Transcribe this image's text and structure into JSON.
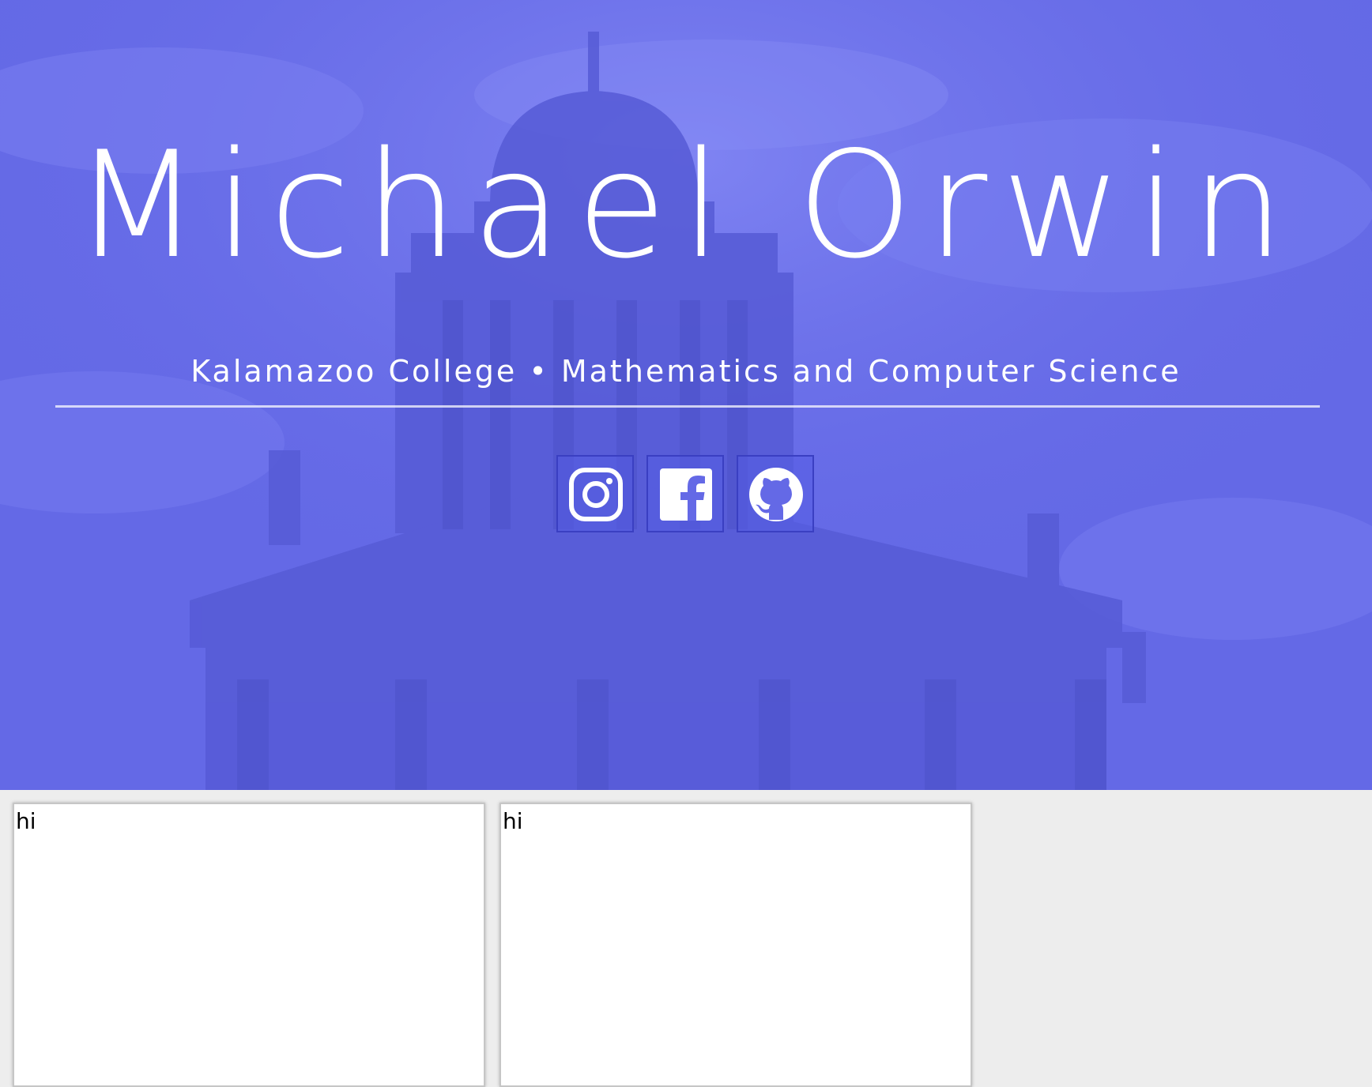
{
  "header": {
    "name": "Michael Orwin",
    "subtitle": "Kalamazoo College • Mathematics and Computer Science",
    "background_color": "#6469e6"
  },
  "social_links": [
    {
      "label": "Instagram",
      "icon": "instagram-icon"
    },
    {
      "label": "Facebook",
      "icon": "facebook-icon"
    },
    {
      "label": "GitHub",
      "icon": "github-icon"
    }
  ],
  "cards": [
    {
      "text": "hi"
    },
    {
      "text": "hi"
    }
  ],
  "colors": {
    "accent": "#6469e6",
    "page_background": "#ededed",
    "card_background": "#ffffff"
  }
}
